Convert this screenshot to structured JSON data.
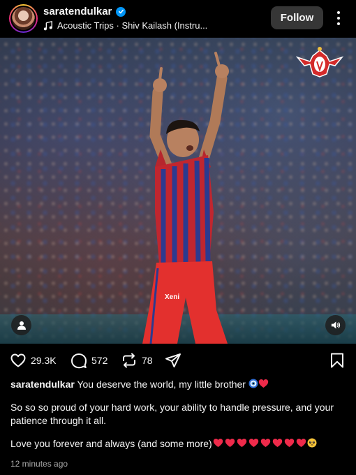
{
  "post": {
    "username": "saratendulkar",
    "audio": "Acoustic Trips · Shiv Kailash (Instru...",
    "follow_label": "Follow",
    "likes": "29.3K",
    "comments": "572",
    "reposts": "78",
    "timestamp": "12 minutes ago"
  },
  "caption": {
    "username": "saratendulkar",
    "line1": "You deserve the world, my little brother",
    "para2": "So so so proud of your hard work, your ability to handle pressure, and your patience through it all.",
    "para3": "Love you forever and always (and some more)"
  },
  "icons": [
    "music-note-icon",
    "verified-badge-icon",
    "more-options-icon",
    "heart-icon",
    "comment-icon",
    "repost-icon",
    "share-icon",
    "bookmark-icon",
    "user-tag-icon",
    "speaker-icon",
    "team-logo"
  ],
  "colors": {
    "verified": "#0095f6",
    "follow_bg": "#363636",
    "heart_emoji": "#ee2a4a"
  }
}
